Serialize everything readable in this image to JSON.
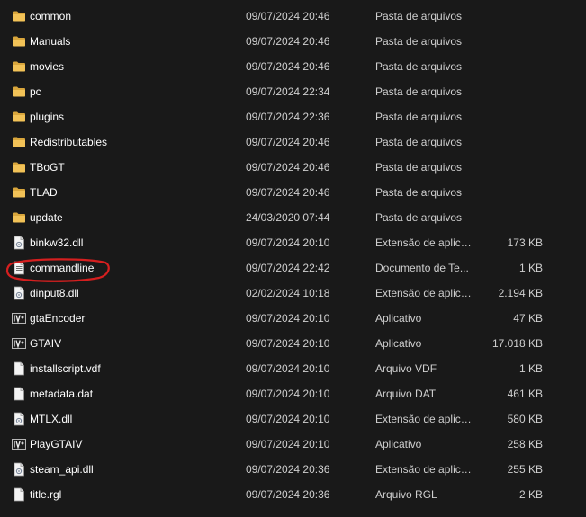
{
  "files": [
    {
      "name": "common",
      "date": "09/07/2024 20:46",
      "type": "Pasta de arquivos",
      "size": "",
      "icon": "folder-icon"
    },
    {
      "name": "Manuals",
      "date": "09/07/2024 20:46",
      "type": "Pasta de arquivos",
      "size": "",
      "icon": "folder-icon"
    },
    {
      "name": "movies",
      "date": "09/07/2024 20:46",
      "type": "Pasta de arquivos",
      "size": "",
      "icon": "folder-icon"
    },
    {
      "name": "pc",
      "date": "09/07/2024 22:34",
      "type": "Pasta de arquivos",
      "size": "",
      "icon": "folder-icon"
    },
    {
      "name": "plugins",
      "date": "09/07/2024 22:36",
      "type": "Pasta de arquivos",
      "size": "",
      "icon": "folder-icon"
    },
    {
      "name": "Redistributables",
      "date": "09/07/2024 20:46",
      "type": "Pasta de arquivos",
      "size": "",
      "icon": "folder-icon"
    },
    {
      "name": "TBoGT",
      "date": "09/07/2024 20:46",
      "type": "Pasta de arquivos",
      "size": "",
      "icon": "folder-icon"
    },
    {
      "name": "TLAD",
      "date": "09/07/2024 20:46",
      "type": "Pasta de arquivos",
      "size": "",
      "icon": "folder-icon"
    },
    {
      "name": "update",
      "date": "24/03/2020 07:44",
      "type": "Pasta de arquivos",
      "size": "",
      "icon": "folder-icon"
    },
    {
      "name": "binkw32.dll",
      "date": "09/07/2024 20:10",
      "type": "Extensão de aplica...",
      "size": "173 KB",
      "icon": "dll-file-icon"
    },
    {
      "name": "commandline",
      "date": "09/07/2024 22:42",
      "type": "Documento de Te...",
      "size": "1 KB",
      "icon": "text-document-icon"
    },
    {
      "name": "dinput8.dll",
      "date": "02/02/2024 10:18",
      "type": "Extensão de aplica...",
      "size": "2.194 KB",
      "icon": "dll-file-icon"
    },
    {
      "name": "gtaEncoder",
      "date": "09/07/2024 20:10",
      "type": "Aplicativo",
      "size": "47 KB",
      "icon": "gtaiv-app-icon"
    },
    {
      "name": "GTAIV",
      "date": "09/07/2024 20:10",
      "type": "Aplicativo",
      "size": "17.018 KB",
      "icon": "gtaiv-app-icon"
    },
    {
      "name": "installscript.vdf",
      "date": "09/07/2024 20:10",
      "type": "Arquivo VDF",
      "size": "1 KB",
      "icon": "blank-file-icon"
    },
    {
      "name": "metadata.dat",
      "date": "09/07/2024 20:10",
      "type": "Arquivo DAT",
      "size": "461 KB",
      "icon": "blank-file-icon"
    },
    {
      "name": "MTLX.dll",
      "date": "09/07/2024 20:10",
      "type": "Extensão de aplica...",
      "size": "580 KB",
      "icon": "dll-file-icon"
    },
    {
      "name": "PlayGTAIV",
      "date": "09/07/2024 20:10",
      "type": "Aplicativo",
      "size": "258 KB",
      "icon": "gtaiv-app-icon"
    },
    {
      "name": "steam_api.dll",
      "date": "09/07/2024 20:36",
      "type": "Extensão de aplica...",
      "size": "255 KB",
      "icon": "dll-file-icon"
    },
    {
      "name": "title.rgl",
      "date": "09/07/2024 20:36",
      "type": "Arquivo RGL",
      "size": "2 KB",
      "icon": "blank-file-icon"
    }
  ],
  "colors": {
    "background": "#191919",
    "folder": "#e8b64a",
    "annotation": "#d51f1f"
  }
}
